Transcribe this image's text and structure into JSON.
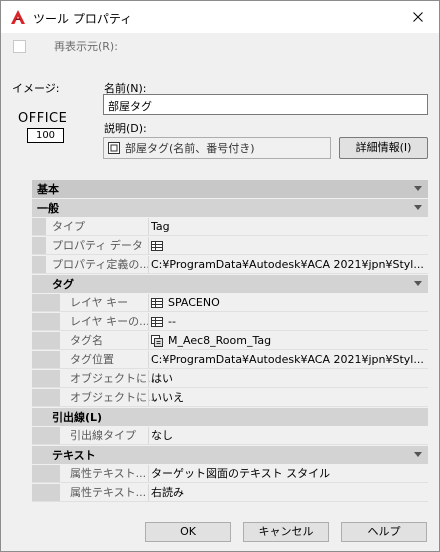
{
  "window": {
    "title": "ツール プロパティ",
    "close_glyph": "✕"
  },
  "redisplay": {
    "label": "再表示元(R):"
  },
  "image": {
    "label": "イメージ:",
    "office_text": "OFFICE",
    "office_box": "100"
  },
  "name": {
    "label": "名前(N):",
    "value": "部屋タグ"
  },
  "description": {
    "label": "説明(D):",
    "value": "部屋タグ(名前、番号付き)"
  },
  "detail_button": "詳細情報(I)",
  "grid": {
    "cat_basic": "基本",
    "cat_general": "一般",
    "general_rows": [
      {
        "name": "タイプ",
        "value": "Tag",
        "icon": ""
      },
      {
        "name": "プロパティ データ",
        "value": "",
        "icon": "table-icon"
      },
      {
        "name": "プロパティ定義の...",
        "value": "C:¥ProgramData¥Autodesk¥ACA  2021¥jpn¥Styl...",
        "icon": ""
      }
    ],
    "cat_tag": "タグ",
    "tag_rows": [
      {
        "name": "レイヤ キー",
        "value": "SPACENO",
        "icon": "table-icon"
      },
      {
        "name": "レイヤ キーの...",
        "value": "--",
        "icon": "table-icon"
      },
      {
        "name": "タグ名",
        "value": "M_Aec8_Room_Tag",
        "icon": "tag-icon"
      },
      {
        "name": "タグ位置",
        "value": "C:¥ProgramData¥Autodesk¥ACA  2021¥jpn¥Styl...",
        "icon": ""
      },
      {
        "name": "オブジェクトに...",
        "value": "はい",
        "icon": ""
      },
      {
        "name": "オブジェクトに...",
        "value": "いいえ",
        "icon": ""
      }
    ],
    "cat_leader": "引出線(L)",
    "leader_rows": [
      {
        "name": "引出線タイプ",
        "value": "なし",
        "icon": ""
      }
    ],
    "cat_text": "テキスト",
    "text_rows": [
      {
        "name": "属性テキスト...",
        "value": "ターゲット図面のテキスト スタイル",
        "icon": ""
      },
      {
        "name": "属性テキスト...",
        "value": "右読み",
        "icon": ""
      }
    ]
  },
  "buttons": {
    "ok": "OK",
    "cancel": "キャンセル",
    "help": "ヘルプ"
  },
  "colors": {
    "app_icon": "#d9252a"
  }
}
